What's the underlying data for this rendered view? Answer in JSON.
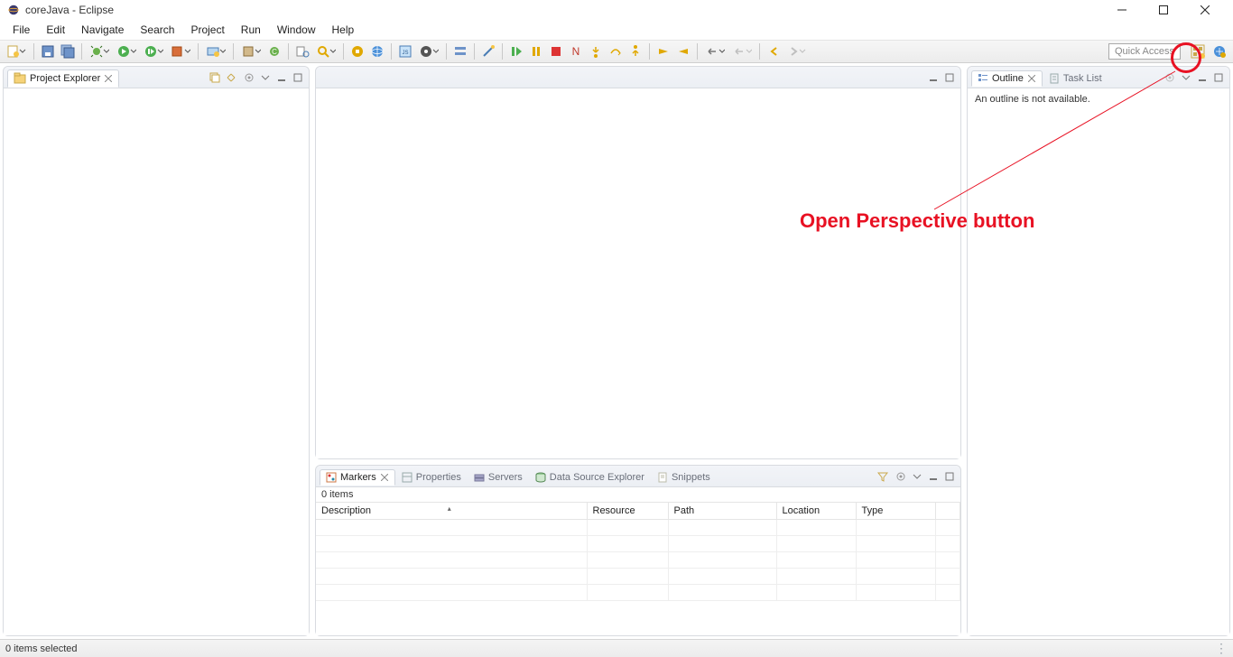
{
  "window": {
    "title": "coreJava - Eclipse"
  },
  "menus": [
    "File",
    "Edit",
    "Navigate",
    "Search",
    "Project",
    "Run",
    "Window",
    "Help"
  ],
  "toolbar": {
    "quick_access": "Quick Access"
  },
  "project_explorer": {
    "title": "Project Explorer"
  },
  "outline": {
    "title": "Outline",
    "message": "An outline is not available."
  },
  "task_list": {
    "title": "Task List"
  },
  "bottom_tabs": {
    "markers": "Markers",
    "properties": "Properties",
    "servers": "Servers",
    "data_source": "Data Source Explorer",
    "snippets": "Snippets"
  },
  "markers": {
    "count_text": "0 items",
    "columns": {
      "description": "Description",
      "resource": "Resource",
      "path": "Path",
      "location": "Location",
      "type": "Type"
    }
  },
  "statusbar": {
    "selection": "0 items selected"
  },
  "annotation": {
    "label": "Open Perspective button"
  }
}
